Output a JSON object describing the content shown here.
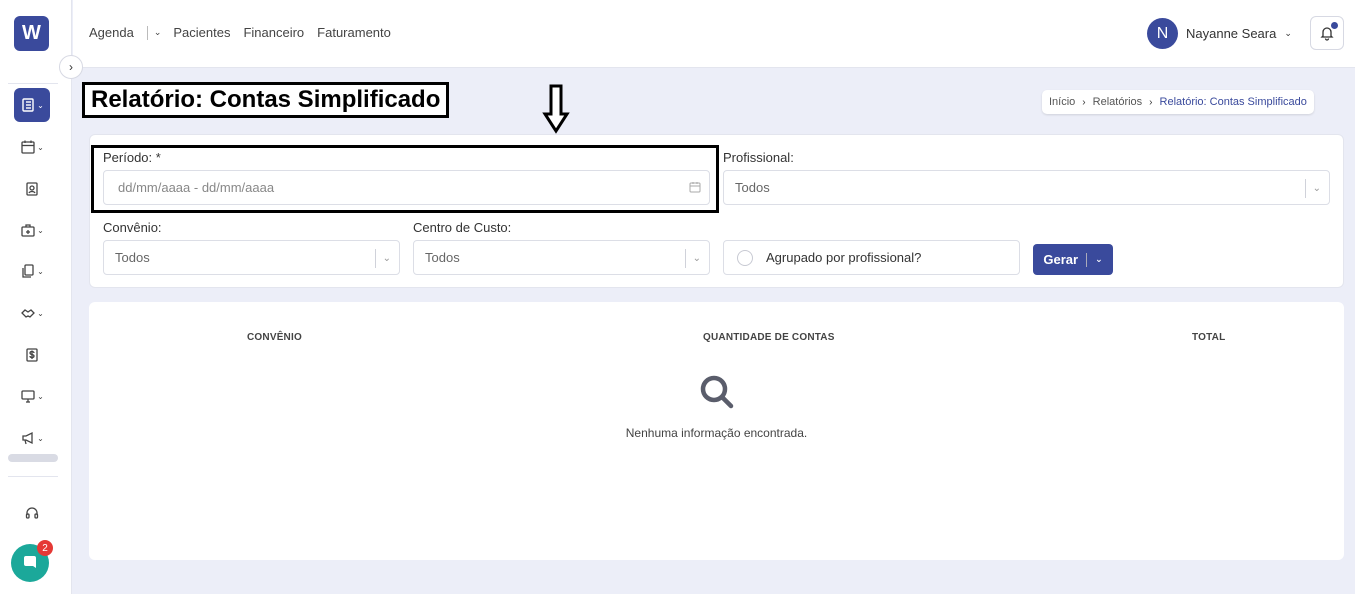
{
  "sidebar": {
    "logo_text": "W",
    "items": [
      "agenda-notebook-icon",
      "calendar-icon",
      "patient-badge-icon",
      "hospital-icon",
      "documents-icon",
      "handshake-icon",
      "dollar-icon",
      "monitor-icon",
      "megaphone-icon"
    ],
    "support_icon": "headset-icon",
    "chat_badge": "2"
  },
  "topnav": {
    "links": [
      "Agenda",
      "Pacientes",
      "Financeiro",
      "Faturamento"
    ],
    "user_initial": "N",
    "user_name": "Nayanne Seara"
  },
  "page": {
    "title": "Relatório: Contas Simplificado",
    "breadcrumb": [
      "Início",
      "Relatórios",
      "Relatório: Contas Simplificado"
    ]
  },
  "filters": {
    "periodo_label": "Período: *",
    "periodo_placeholder": "dd/mm/aaaa - dd/mm/aaaa",
    "profissional_label": "Profissional:",
    "profissional_value": "Todos",
    "convenio_label": "Convênio:",
    "convenio_value": "Todos",
    "centro_label": "Centro de Custo:",
    "centro_value": "Todos",
    "agrupado_label": "Agrupado por profissional?",
    "gerar_label": "Gerar"
  },
  "results": {
    "columns": [
      "CONVÊNIO",
      "QUANTIDADE DE CONTAS",
      "TOTAL"
    ],
    "empty_message": "Nenhuma informação encontrada."
  },
  "colors": {
    "primary": "#3a4a9c",
    "chat": "#1ba89a",
    "badge": "#e53935"
  }
}
